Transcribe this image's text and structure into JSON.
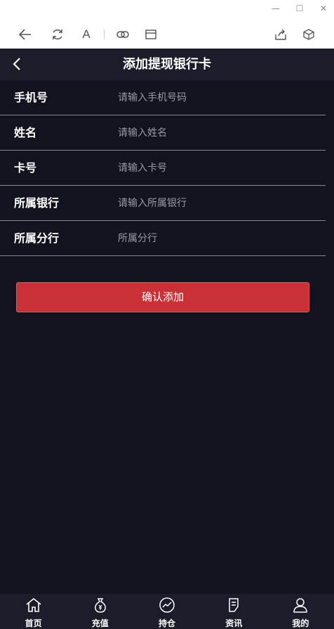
{
  "window": {
    "minimize_glyph": "—",
    "maximize_glyph": "☐",
    "close_glyph": "✕"
  },
  "browser_toolbar": {
    "font_button_glyph": "A",
    "icons": [
      "back-arrow-icon",
      "refresh-icon",
      "font-size-icon",
      "link-icon",
      "window-icon",
      "share-icon",
      "cube-icon"
    ]
  },
  "header": {
    "title": "添加提现银行卡"
  },
  "form": {
    "rows": [
      {
        "label": "手机号",
        "placeholder": "请输入手机号码"
      },
      {
        "label": "姓名",
        "placeholder": "请输入姓名"
      },
      {
        "label": "卡号",
        "placeholder": "请输入卡号"
      },
      {
        "label": "所属银行",
        "placeholder": "请输入所属银行"
      },
      {
        "label": "所属分行",
        "placeholder": "所属分行"
      }
    ]
  },
  "confirm_button": {
    "label": "确认添加"
  },
  "tabbar": {
    "tabs": [
      {
        "label": "首页",
        "icon": "home-icon"
      },
      {
        "label": "充值",
        "icon": "money-bag-icon"
      },
      {
        "label": "持仓",
        "icon": "chart-trend-icon"
      },
      {
        "label": "资讯",
        "icon": "document-edit-icon"
      },
      {
        "label": "我的",
        "icon": "user-icon"
      }
    ]
  },
  "colors": {
    "background": "#13121f",
    "header": "#1b1d2b",
    "accent_red": "#c93137",
    "divider": "#8a8a93"
  }
}
